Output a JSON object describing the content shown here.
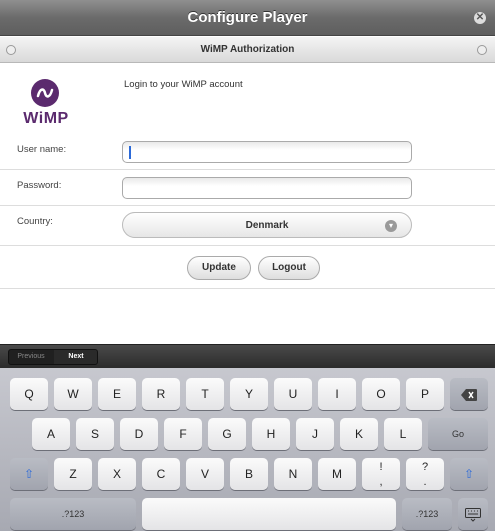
{
  "window": {
    "title": "Configure Player"
  },
  "subheader": {
    "title": "WiMP Authorization"
  },
  "logo": {
    "word": "WiMP"
  },
  "intro": "Login to your WiMP account",
  "form": {
    "username_label": "User name:",
    "username_value": "",
    "password_label": "Password:",
    "password_value": "",
    "country_label": "Country:",
    "country_value": "Denmark"
  },
  "buttons": {
    "update": "Update",
    "logout": "Logout"
  },
  "keyboard": {
    "nav": {
      "previous": "Previous",
      "next": "Next"
    },
    "row1": [
      "Q",
      "W",
      "E",
      "R",
      "T",
      "Y",
      "U",
      "I",
      "O",
      "P"
    ],
    "row2": [
      "A",
      "S",
      "D",
      "F",
      "G",
      "H",
      "J",
      "K",
      "L"
    ],
    "row3": [
      "Z",
      "X",
      "C",
      "V",
      "B",
      "N",
      "M"
    ],
    "go": "Go",
    "numbers": ".?123",
    "punct1": [
      "!",
      ","
    ],
    "punct2": [
      "?",
      "."
    ]
  },
  "icons": {
    "close": "close-icon",
    "backspace": "backspace-icon",
    "shift": "shift-icon",
    "hide_keyboard": "keyboard-hide-icon",
    "select": "chevron-down-icon"
  },
  "colors": {
    "accent": "#5b2a6e",
    "caret": "#2c6ad8"
  }
}
